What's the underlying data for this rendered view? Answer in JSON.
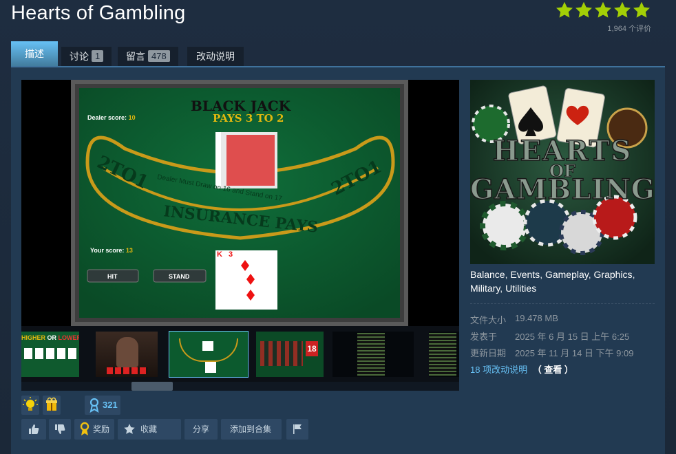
{
  "page": {
    "title": "Hearts of Gambling"
  },
  "rating": {
    "stars": 5,
    "count_text": "1,964 个评价",
    "star_color": "#a3cf06"
  },
  "tabs": [
    {
      "label": "描述",
      "active": true
    },
    {
      "label": "讨论",
      "count": "1"
    },
    {
      "label": "留言",
      "count": "478"
    },
    {
      "label": "改动说明"
    }
  ],
  "media": {
    "blackjack": {
      "title_line1": "BLACK JACK",
      "title_line2": "PAYS 3 TO 2",
      "dealer_score_label": "Dealer score:",
      "dealer_score": "10",
      "your_score_label": "Your score:",
      "your_score": "13",
      "arc_left": "2TO1",
      "arc_right": "2TO1",
      "insurance_text": "INSURANCE PAYS",
      "dealer_rule": "Dealer Must Draw on 16 and Stand on 17",
      "hit_label": "HIT",
      "stand_label": "STAND",
      "player_card_1": "K",
      "player_card_2": "3"
    },
    "thumb1_text_a": "HIGHER",
    "thumb1_text_b": "OR",
    "thumb1_text_c": "LOWER",
    "thumb4_number": "18"
  },
  "capsule": {
    "line1": "HEARTS",
    "line2": "OF",
    "line3": "GAMBLING"
  },
  "tags": [
    "Balance",
    "Events",
    "Gameplay",
    "Graphics",
    "Military",
    "Utilities"
  ],
  "details": {
    "size_label": "文件大小",
    "size_value": "19.478 MB",
    "posted_label": "发表于",
    "posted_value": "2025 年 6 月 15 日 上午 6:25",
    "updated_label": "更新日期",
    "updated_value": "2025 年 11 月 14 日 下午 9:09"
  },
  "changes": {
    "link_text": "18 项改动说明",
    "view_text": "（ 查看 ）"
  },
  "awards": {
    "count": "321"
  },
  "actions": {
    "award_label": "奖励",
    "favorite_label": "收藏",
    "share_label": "分享",
    "collection_label": "添加到合集"
  }
}
